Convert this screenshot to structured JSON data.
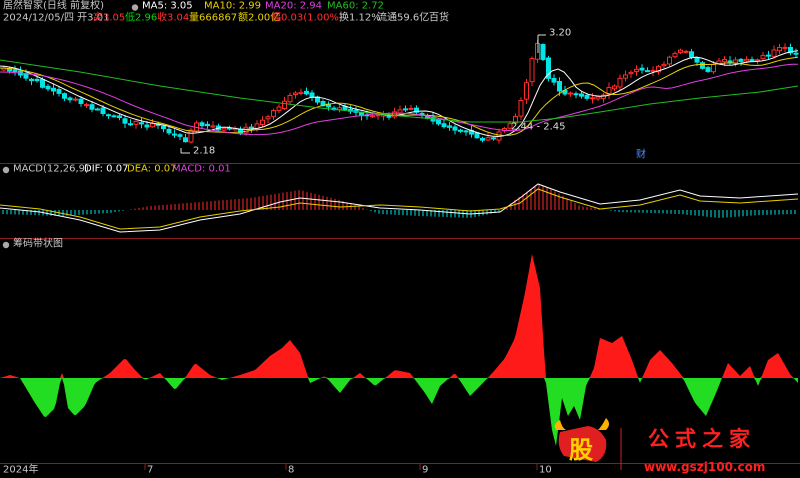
{
  "window": {
    "app_title": "居然智家(日线 前复权)"
  },
  "colors": {
    "up": "#ff2a2a",
    "down": "#00e5e5",
    "ma5": "#ffffff",
    "ma10": "#e8d000",
    "ma20": "#e040e0",
    "ma60": "#22bb22",
    "text": "#c8c8c8",
    "separator": "#8b1a1a",
    "chip_up": "#ff1a1a",
    "chip_down": "#22dd22"
  },
  "header": {
    "ma5_label": "MA5: 3.05",
    "ma10_label": "MA10: 2.99",
    "ma20_label": "MA20: 2.94",
    "ma60_label": "MA60: 2.72"
  },
  "info": {
    "date_open": "2024/12/05/四 开3.01",
    "high": "高3.05",
    "low": "低2.96",
    "close": "收3.04",
    "volume": "量666867",
    "amount": "额2.00亿",
    "change": "幅0.03(1.00%)",
    "turnover": "换1.12%",
    "float_mv": "流通59.6亿",
    "menu": "百货"
  },
  "price_annotations": {
    "max_label": "3.20",
    "min_label": "2.18",
    "range_label": "2.44 - 2.45",
    "fin_badge": "财"
  },
  "macd": {
    "title": "MACD(12,26,9)",
    "dif": "DIF: 0.07",
    "dea": "DEA: 0.07",
    "macd": "MACD: 0.01"
  },
  "chip": {
    "title": "筹码带状图"
  },
  "x_axis": {
    "labels": [
      "2024年",
      "7",
      "8",
      "9",
      "10"
    ]
  },
  "watermark": {
    "logo_char": "股",
    "brand": "公式之家",
    "url": "www.gszj100.com"
  }
}
